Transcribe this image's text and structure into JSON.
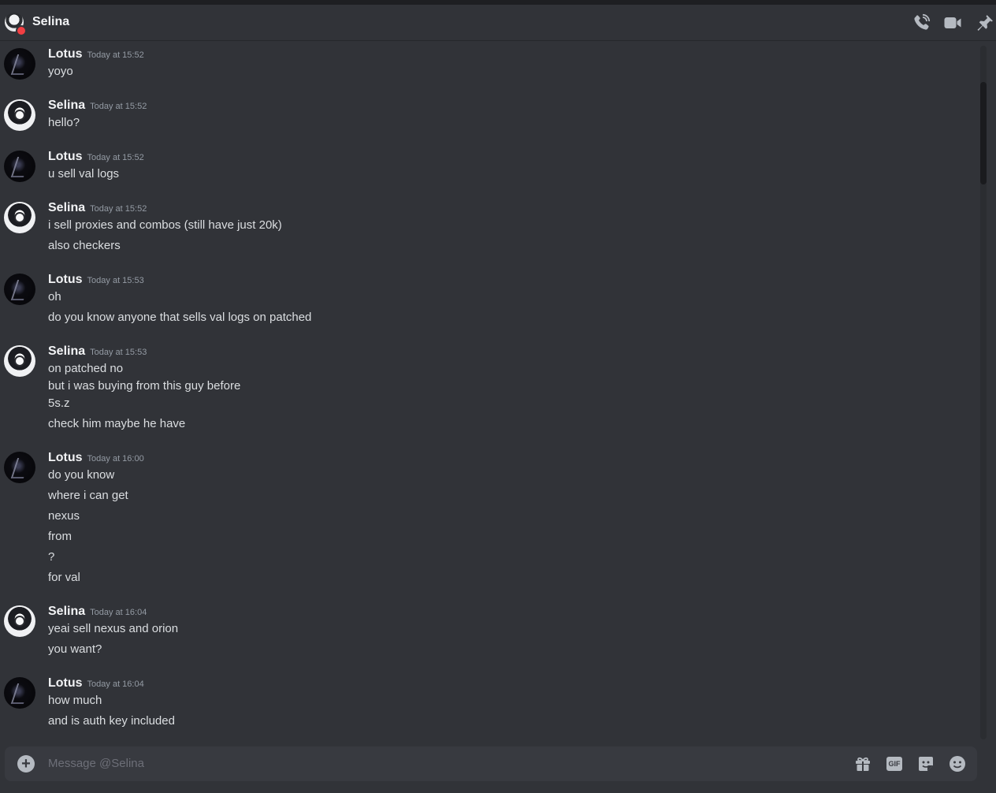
{
  "header": {
    "title": "Selina",
    "icons": [
      "call-icon",
      "video-call-icon",
      "pin-icon"
    ]
  },
  "messages": [
    {
      "author": "Lotus",
      "timestamp": "Today at 15:52",
      "lines": [
        "yoyo"
      ]
    },
    {
      "author": "Selina",
      "timestamp": "Today at 15:52",
      "lines": [
        "hello?"
      ]
    },
    {
      "author": "Lotus",
      "timestamp": "Today at 15:52",
      "lines": [
        "u sell val logs"
      ]
    },
    {
      "author": "Selina",
      "timestamp": "Today at 15:52",
      "lines": [
        "i sell proxies and combos (still have just 20k)",
        "also checkers"
      ]
    },
    {
      "author": "Lotus",
      "timestamp": "Today at 15:53",
      "lines": [
        "oh",
        "do you know anyone that sells val logs on patched"
      ]
    },
    {
      "author": "Selina",
      "timestamp": "Today at 15:53",
      "lines": [
        "on patched no",
        "but i was buying from this guy before",
        "5s.z",
        "check him maybe he have"
      ]
    },
    {
      "author": "Lotus",
      "timestamp": "Today at 16:00",
      "lines": [
        "do you know",
        "where i can get",
        "nexus",
        "from",
        "?",
        "for val"
      ]
    },
    {
      "author": "Selina",
      "timestamp": "Today at 16:04",
      "lines": [
        "yeai sell nexus and orion",
        "you want?"
      ]
    },
    {
      "author": "Lotus",
      "timestamp": "Today at 16:04",
      "lines": [
        "how much",
        "and is auth key included"
      ]
    }
  ],
  "composer": {
    "placeholder": "Message @Selina",
    "gif_label": "GIF",
    "icons": [
      "add-attachment-icon",
      "gift-icon",
      "gif-icon",
      "sticker-icon",
      "emoji-icon"
    ]
  }
}
